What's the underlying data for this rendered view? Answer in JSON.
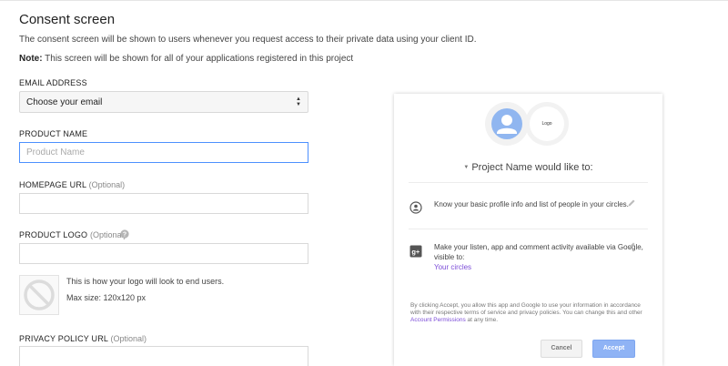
{
  "header": {
    "title": "Consent screen",
    "description": "The consent screen will be shown to users whenever you request access to their private data using your client ID.",
    "note_label": "Note:",
    "note_text": " This screen will be shown for all of your applications registered in this project"
  },
  "form": {
    "email": {
      "label": "EMAIL ADDRESS",
      "selected": "Choose your email"
    },
    "product_name": {
      "label": "PRODUCT NAME",
      "placeholder": "Product Name",
      "value": ""
    },
    "homepage_url": {
      "label": "HOMEPAGE URL",
      "optional": "(Optional)",
      "value": ""
    },
    "product_logo": {
      "label": "PRODUCT LOGO",
      "optional": "(Optional)",
      "value": "",
      "help_icon": "help-circle-icon",
      "preview_text": "This is how your logo will look to end users.",
      "max_size": "Max size: 120x120 px"
    },
    "privacy_policy_url": {
      "label": "PRIVACY POLICY URL",
      "optional": "(Optional)",
      "value": ""
    }
  },
  "preview": {
    "logo_placeholder": "Logo",
    "heading": "Project Name would like to:",
    "permissions": [
      {
        "icon": "profile-icon",
        "text": "Know your basic profile info and list of people in your circles."
      },
      {
        "icon": "google-plus-icon",
        "text": "Make your listen, app and comment activity available via Google, visible to:",
        "link": "Your circles"
      }
    ],
    "legal_text_1": "By clicking Accept, you allow this app and Google to use your information in accordance with their respective terms of service and privacy policies. You can change this and other ",
    "legal_link": "Account Permissions",
    "legal_text_2": " at any time.",
    "cancel_label": "Cancel",
    "accept_label": "Accept"
  },
  "colors": {
    "focus_border": "#4d90fe",
    "accept_button": "#8fb3f5",
    "link": "#7c4dd8",
    "avatar": "#90b6f0"
  }
}
